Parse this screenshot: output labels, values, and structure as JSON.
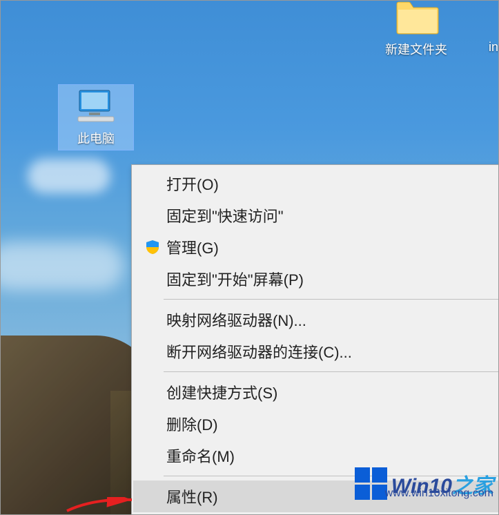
{
  "desktop_icons": {
    "this_pc": {
      "label": "此电脑"
    },
    "new_folder": {
      "label": "新建文件夹"
    },
    "truncated": {
      "label": "in"
    }
  },
  "context_menu": {
    "open": {
      "label": "打开(O)"
    },
    "pin_quick": {
      "label": "固定到\"快速访问\""
    },
    "manage": {
      "label": "管理(G)"
    },
    "pin_start": {
      "label": "固定到\"开始\"屏幕(P)"
    },
    "map_drive": {
      "label": "映射网络驱动器(N)..."
    },
    "disconnect": {
      "label": "断开网络驱动器的连接(C)..."
    },
    "shortcut": {
      "label": "创建快捷方式(S)"
    },
    "delete": {
      "label": "删除(D)"
    },
    "rename": {
      "label": "重命名(M)"
    },
    "properties": {
      "label": "属性(R)"
    }
  },
  "watermark": {
    "brand_a": "Win10",
    "brand_b": "之家",
    "url": "www.win10xitong.com"
  }
}
